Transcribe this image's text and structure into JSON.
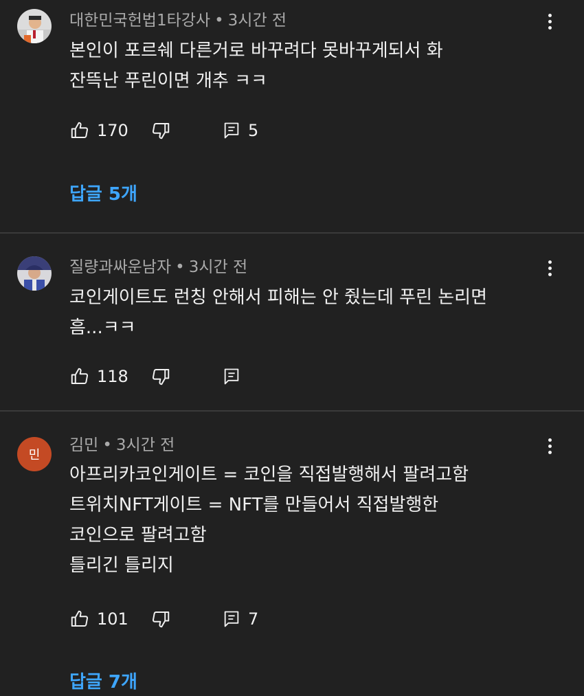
{
  "comments": [
    {
      "author": "대한민국헌법1타강사",
      "time": "3시간 전",
      "lines": [
        "본인이 포르쉐 다른거로 바꾸려다 못바꾸게되서 화",
        "잔뜩난 푸린이면 개추 ㅋㅋ"
      ],
      "likes": "170",
      "reply_count": "5",
      "replies_link": "답글 5개"
    },
    {
      "author": "질량과싸운남자",
      "time": "3시간 전",
      "lines": [
        "코인게이트도 런칭 안해서 피해는 안 줬는데 푸린 논리면",
        "흠...ㅋㅋ"
      ],
      "likes": "118",
      "reply_count": "",
      "replies_link": ""
    },
    {
      "author": "김민",
      "avatar_letter": "민",
      "time": "3시간 전",
      "lines": [
        "아프리카코인게이트 = 코인을 직접발행해서 팔려고함",
        "트위치NFT게이트 = NFT를 만들어서 직접발행한",
        "코인으로 팔려고함",
        "틀리긴 틀리지"
      ],
      "likes": "101",
      "reply_count": "7",
      "replies_link": "답글 7개"
    }
  ],
  "separator": "•",
  "icons": {
    "like": "thumb-up-icon",
    "dislike": "thumb-down-icon",
    "reply": "reply-comment-icon",
    "more": "more-vertical-icon"
  },
  "colors": {
    "background": "#212121",
    "text": "#f1f1f1",
    "meta": "#aaaaaa",
    "link": "#3ea6ff",
    "avatar_letter_bg": "#c44a24"
  }
}
